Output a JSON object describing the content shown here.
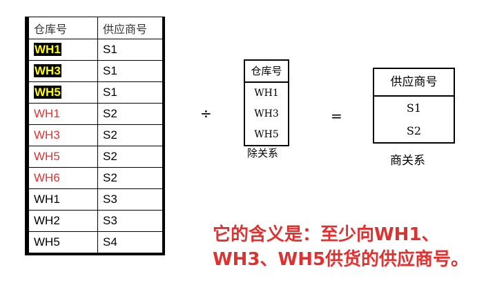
{
  "left_table": {
    "headers": [
      "仓库号",
      "供应商号"
    ],
    "rows": [
      {
        "wh": "WH1",
        "sup": "S1",
        "style": "hl"
      },
      {
        "wh": "WH3",
        "sup": "S1",
        "style": "hl"
      },
      {
        "wh": "WH5",
        "sup": "S1",
        "style": "hl"
      },
      {
        "wh": "WH1",
        "sup": "S2",
        "style": "red"
      },
      {
        "wh": "WH3",
        "sup": "S2",
        "style": "red"
      },
      {
        "wh": "WH5",
        "sup": "S2",
        "style": "red"
      },
      {
        "wh": "WH6",
        "sup": "S2",
        "style": "red"
      },
      {
        "wh": "WH1",
        "sup": "S3",
        "style": ""
      },
      {
        "wh": "WH2",
        "sup": "S3",
        "style": ""
      },
      {
        "wh": "WH5",
        "sup": "S4",
        "style": ""
      }
    ]
  },
  "divide_op": "÷",
  "equals_op": "=",
  "divisor": {
    "header": "仓库号",
    "rows": [
      "WH1",
      "WH3",
      "WH5"
    ],
    "caption": "除关系"
  },
  "result": {
    "header": "供应商号",
    "rows": [
      "S1",
      "S2"
    ],
    "caption": "商关系"
  },
  "note": {
    "line1": "它的含义是：至少向WH1、",
    "line2": "WH3、WH5供货的供应商号。"
  },
  "colors": {
    "highlight_bg": "#000000",
    "highlight_fg": "#ffff00",
    "red": "#e03131"
  }
}
